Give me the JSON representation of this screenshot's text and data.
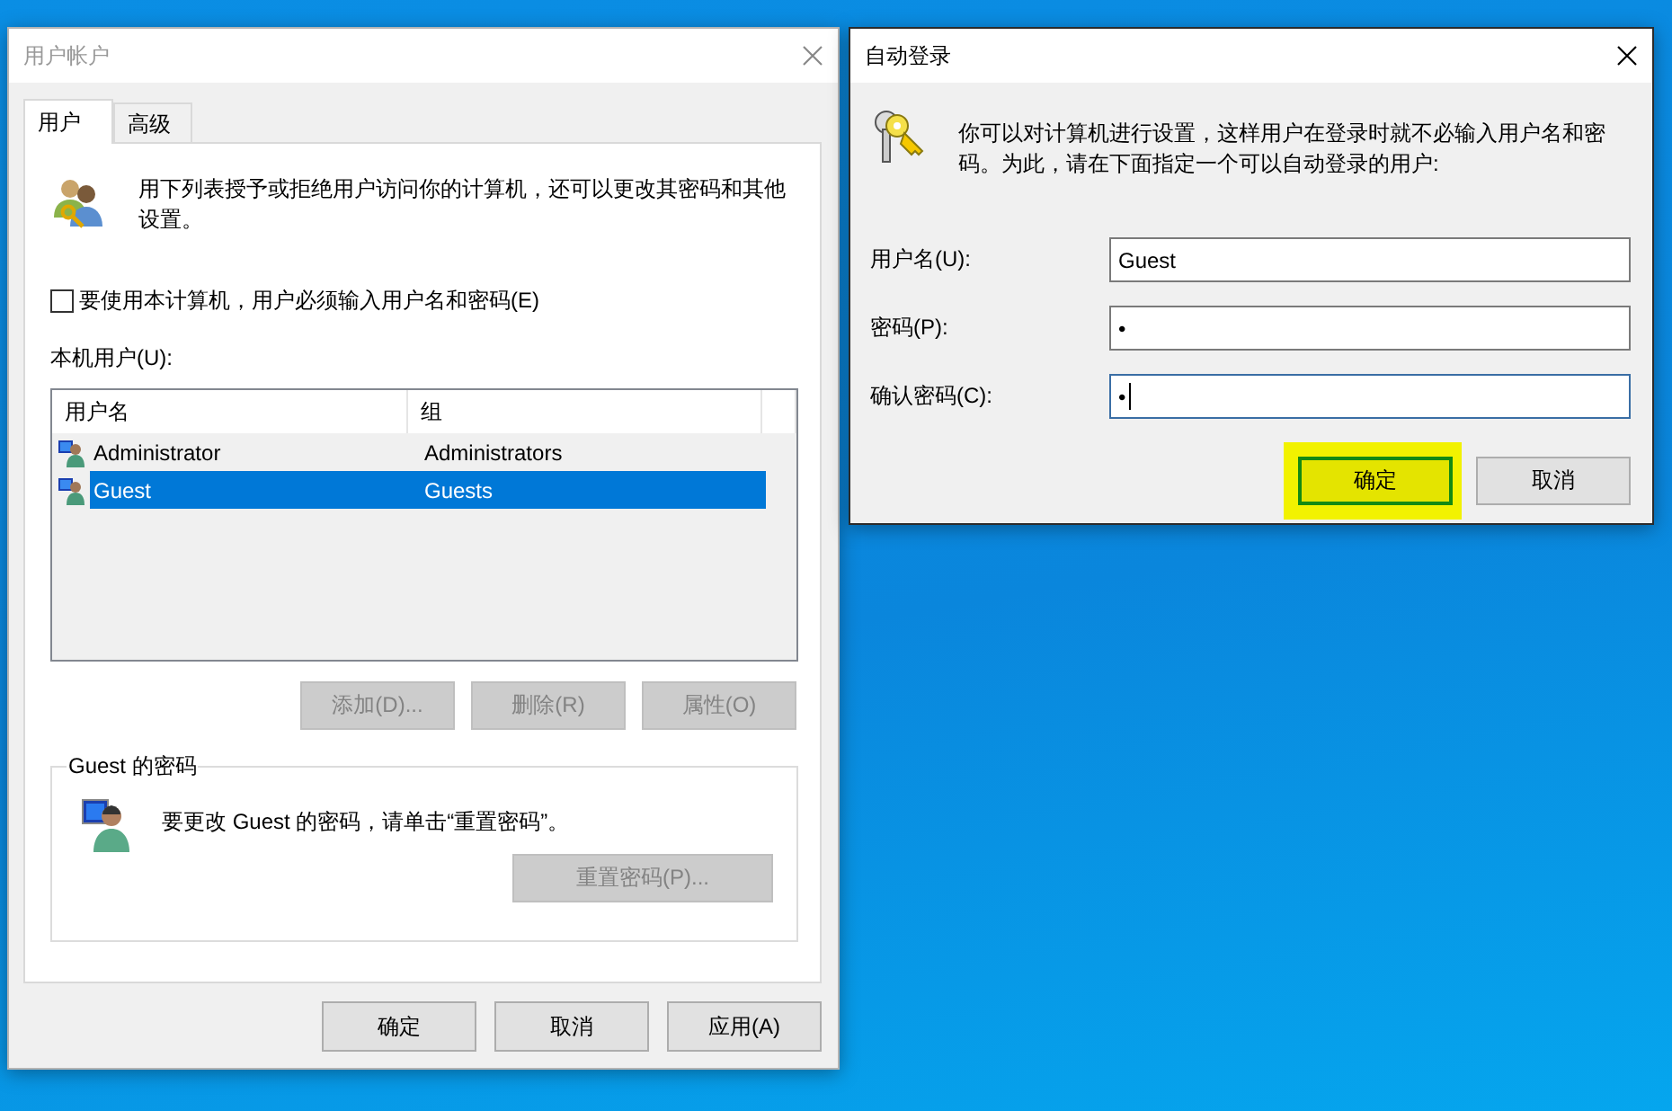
{
  "accounts_window": {
    "title": "用户帐户",
    "active": false,
    "tabs": [
      {
        "label": "用户",
        "selected": true
      },
      {
        "label": "高级",
        "selected": false
      }
    ],
    "intro": "用下列表授予或拒绝用户访问你的计算机，还可以更改其密码和其他设置。",
    "require_password": {
      "label": "要使用本计算机，用户必须输入用户名和密码(E)",
      "checked": false
    },
    "users_label": "本机用户(U):",
    "table": {
      "columns": [
        "用户名",
        "组"
      ],
      "rows": [
        {
          "name": "Administrator",
          "group": "Administrators",
          "selected": false
        },
        {
          "name": "Guest",
          "group": "Guests",
          "selected": true
        }
      ]
    },
    "list_buttons": [
      {
        "label": "添加(D)...",
        "disabled": true
      },
      {
        "label": "删除(R)",
        "disabled": true
      },
      {
        "label": "属性(O)",
        "disabled": true
      }
    ],
    "password_group": {
      "title": "Guest 的密码",
      "text": "要更改 Guest 的密码，请单击“重置密码”。",
      "button": {
        "label": "重置密码(P)...",
        "disabled": true
      }
    },
    "buttons": [
      {
        "label": "确定",
        "disabled": false
      },
      {
        "label": "取消",
        "disabled": false
      },
      {
        "label": "应用(A)",
        "disabled": false
      }
    ]
  },
  "autologon_window": {
    "title": "自动登录",
    "active": true,
    "text": "你可以对计算机进行设置，这样用户在登录时就不必输入用户名和密码。为此，请在下面指定一个可以自动登录的用户:",
    "fields": [
      {
        "label": "用户名(U):",
        "value": "Guest",
        "focused": false
      },
      {
        "label": "密码(P):",
        "value": "•",
        "focused": false
      },
      {
        "label": "确认密码(C):",
        "value": "•",
        "focused": true
      }
    ],
    "buttons": [
      {
        "label": "确定",
        "highlighted": true
      },
      {
        "label": "取消",
        "highlighted": false
      }
    ]
  }
}
